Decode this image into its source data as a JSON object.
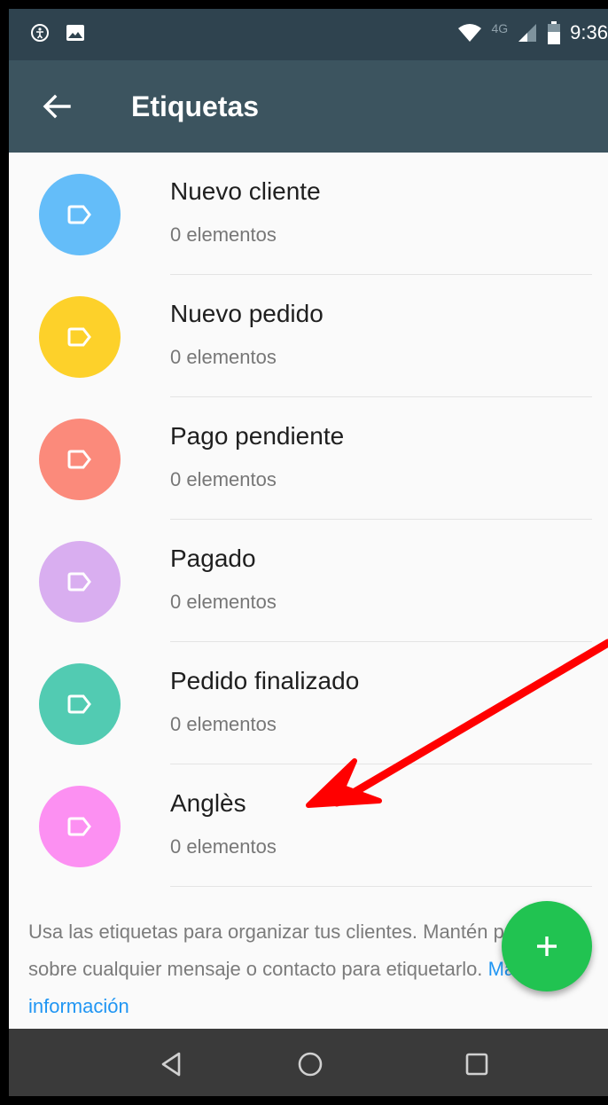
{
  "status_bar": {
    "time": "9:36",
    "network": "4G"
  },
  "app_bar": {
    "title": "Etiquetas"
  },
  "labels": [
    {
      "name": "Nuevo cliente",
      "count": "0 elementos",
      "color": "#64bdf9"
    },
    {
      "name": "Nuevo pedido",
      "count": "0 elementos",
      "color": "#fdd12a"
    },
    {
      "name": "Pago pendiente",
      "count": "0 elementos",
      "color": "#fb8a7b"
    },
    {
      "name": "Pagado",
      "count": "0 elementos",
      "color": "#d9aef0"
    },
    {
      "name": "Pedido finalizado",
      "count": "0 elementos",
      "color": "#52cbb2"
    },
    {
      "name": "Anglès",
      "count": "0 elementos",
      "color": "#fc90f2"
    }
  ],
  "footer": {
    "text": "Usa las etiquetas para organizar tus clientes. Mantén presionado sobre cualquier mensaje o contacto para etiquetarlo.",
    "link": "Más información"
  },
  "colors": {
    "status_bar": "#2f434f",
    "app_bar": "#3c545f",
    "fab": "#21c351",
    "link": "#2196f3",
    "arrow": "#ff0000"
  }
}
